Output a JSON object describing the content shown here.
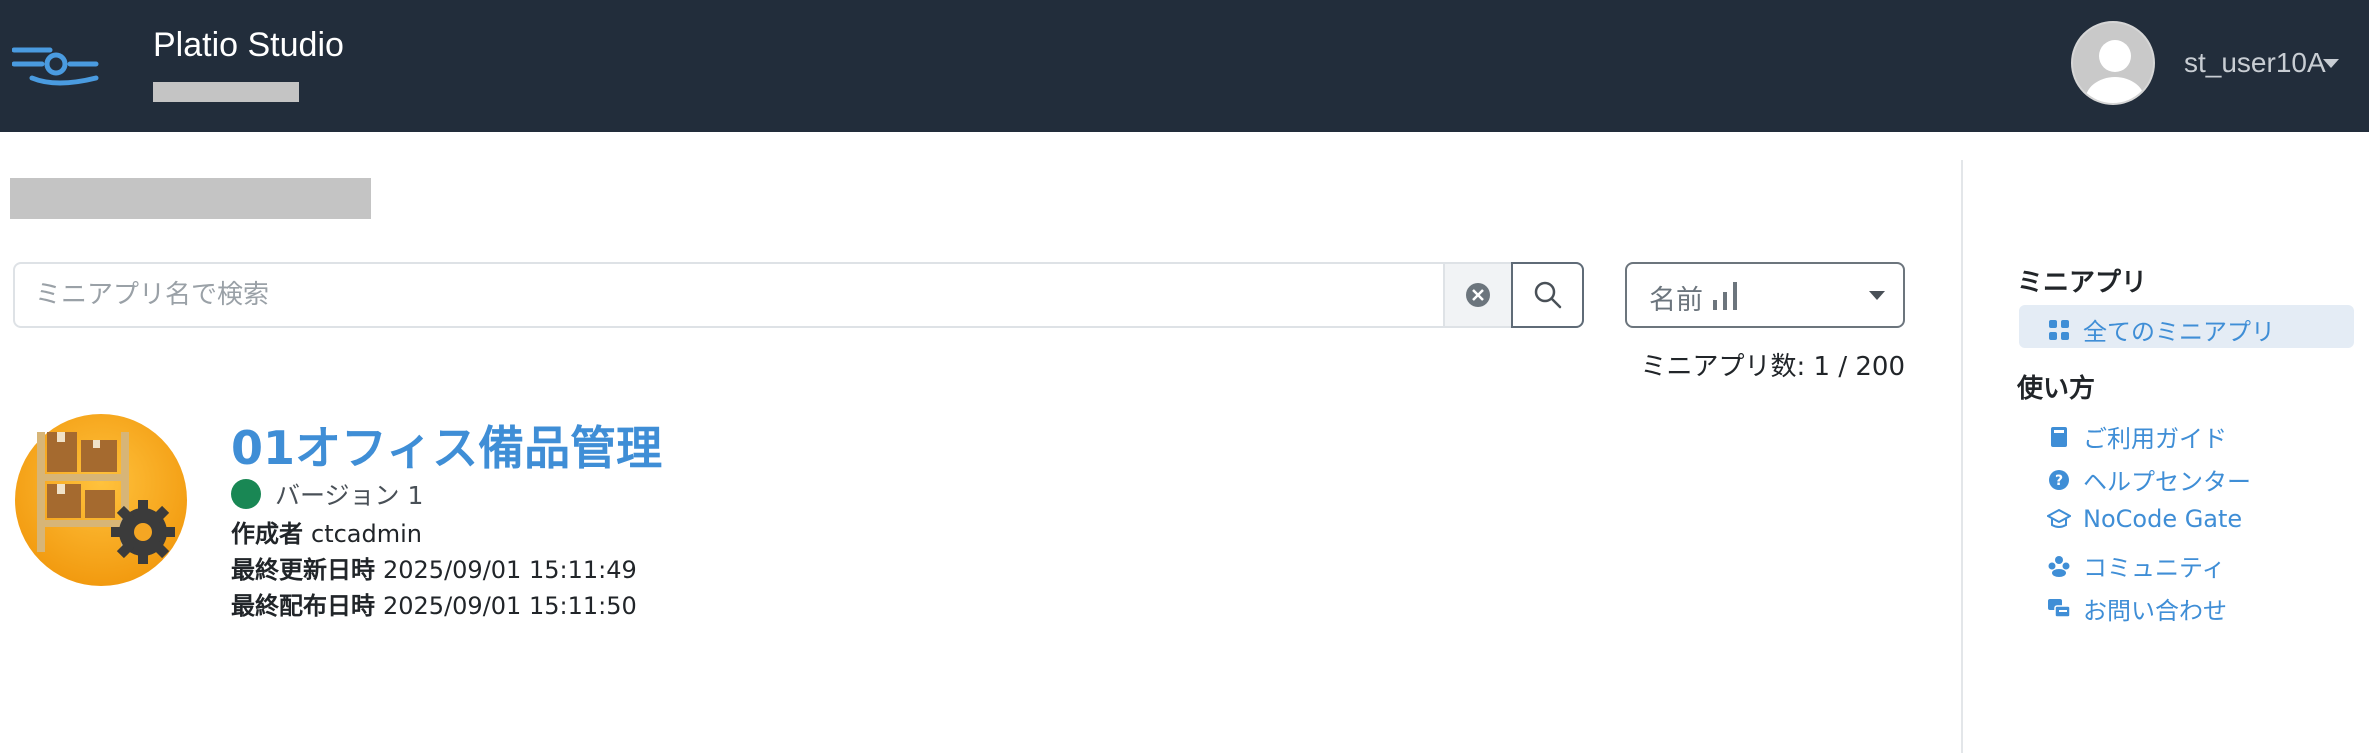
{
  "header": {
    "app_title": "Platio Studio",
    "user_name": "st_user10A",
    "colors": {
      "background": "#222d3b",
      "logo_accent": "#4a9be0"
    }
  },
  "search": {
    "placeholder": "ミニアプリ名で検索",
    "value": ""
  },
  "sort": {
    "selected": "名前"
  },
  "count": {
    "text": "ミニアプリ数: 1 / 200"
  },
  "apps": [
    {
      "name": "01オフィス備品管理",
      "version_label": "バージョン 1",
      "status_color": "#198754",
      "author_label": "作成者",
      "author": "ctcadmin",
      "updated_label": "最終更新日時",
      "updated": "2025/09/01 15:11:49",
      "published_label": "最終配布日時",
      "published": "2025/09/01 15:11:50",
      "icon": "shelf-gear-icon"
    }
  ],
  "sidebar": {
    "miniapps_heading": "ミニアプリ",
    "all_miniapps": "全てのミニアプリ",
    "howto_heading": "使い方",
    "links": [
      {
        "label": "ご利用ガイド",
        "icon": "book-icon"
      },
      {
        "label": "ヘルプセンター",
        "icon": "question-circle-icon"
      },
      {
        "label": "NoCode Gate",
        "icon": "mortarboard-icon"
      },
      {
        "label": "コミュニティ",
        "icon": "people-icon"
      },
      {
        "label": "お問い合わせ",
        "icon": "chat-icon"
      }
    ],
    "colors": {
      "link": "#3f8ed6",
      "active_bg": "#e4ecf5"
    }
  }
}
